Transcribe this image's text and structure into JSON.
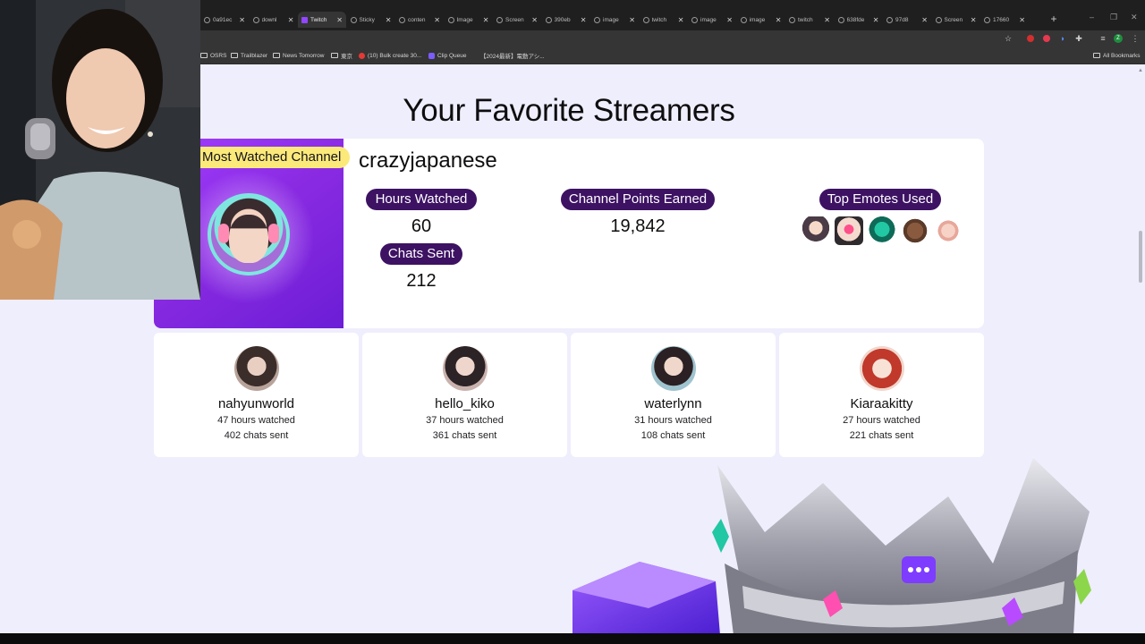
{
  "browser": {
    "tabs": [
      {
        "label": "0a91ec",
        "icon": "globe-icon"
      },
      {
        "label": "downl",
        "icon": "globe-icon"
      },
      {
        "label": "Twitch",
        "icon": "twitch-icon",
        "active": true
      },
      {
        "label": "Sticky",
        "icon": "globe-icon"
      },
      {
        "label": "conten",
        "icon": "globe-icon"
      },
      {
        "label": "Image",
        "icon": "globe-icon"
      },
      {
        "label": "Screen",
        "icon": "globe-icon"
      },
      {
        "label": "390eb",
        "icon": "globe-icon"
      },
      {
        "label": "image",
        "icon": "globe-icon"
      },
      {
        "label": "twitch",
        "icon": "globe-icon"
      },
      {
        "label": "image",
        "icon": "globe-icon"
      },
      {
        "label": "image",
        "icon": "globe-icon"
      },
      {
        "label": "twitch",
        "icon": "globe-icon"
      },
      {
        "label": "638fde",
        "icon": "globe-icon"
      },
      {
        "label": "97d8",
        "icon": "globe-icon"
      },
      {
        "label": "Screen",
        "icon": "globe-icon"
      },
      {
        "label": "17660",
        "icon": "globe-icon"
      }
    ],
    "bookmarks": [
      {
        "label": "OSRS",
        "icon": "folder-icon"
      },
      {
        "label": "Trailblazer",
        "icon": "folder-icon"
      },
      {
        "label": "News Tomorrow",
        "icon": "folder-icon"
      },
      {
        "label": "東京",
        "icon": "folder-icon"
      },
      {
        "label": "(10) Bulk create 30...",
        "icon": "youtube-icon"
      },
      {
        "label": "Clip Queue",
        "icon": "clip-queue-icon"
      },
      {
        "label": "【2024最新】電動アシ...",
        "icon": "none"
      }
    ],
    "all_bookmarks": "All Bookmarks"
  },
  "page": {
    "title": "Your Favorite Streamers",
    "top_channel": {
      "badge": "Most Watched Channel",
      "name": "crazyjapanese",
      "hours_label": "Hours Watched",
      "hours_value": "60",
      "chats_label": "Chats Sent",
      "chats_value": "212",
      "points_label": "Channel Points Earned",
      "points_value": "19,842",
      "emotes_label": "Top Emotes Used",
      "emotes": [
        "emote-1",
        "emote-2",
        "emote-3",
        "emote-4",
        "emote-5"
      ]
    },
    "streamers": [
      {
        "name": "nahyunworld",
        "hours": "47 hours watched",
        "chats": "402 chats sent",
        "avatar_color": "#b8a39a"
      },
      {
        "name": "hello_kiko",
        "hours": "37 hours watched",
        "chats": "361 chats sent",
        "avatar_color": "#c9b2ad"
      },
      {
        "name": "waterlynn",
        "hours": "31 hours watched",
        "chats": "108 chats sent",
        "avatar_color": "#9fc3cf"
      },
      {
        "name": "Kiaraakitty",
        "hours": "27 hours watched",
        "chats": "221 chats sent",
        "avatar_color": "#f1d6cb"
      }
    ]
  },
  "colors": {
    "page_bg": "#efeefc",
    "pill_bg": "#3d1263",
    "badge_yellow": "#fbea7a",
    "hero_purple": "#8a2be2"
  }
}
